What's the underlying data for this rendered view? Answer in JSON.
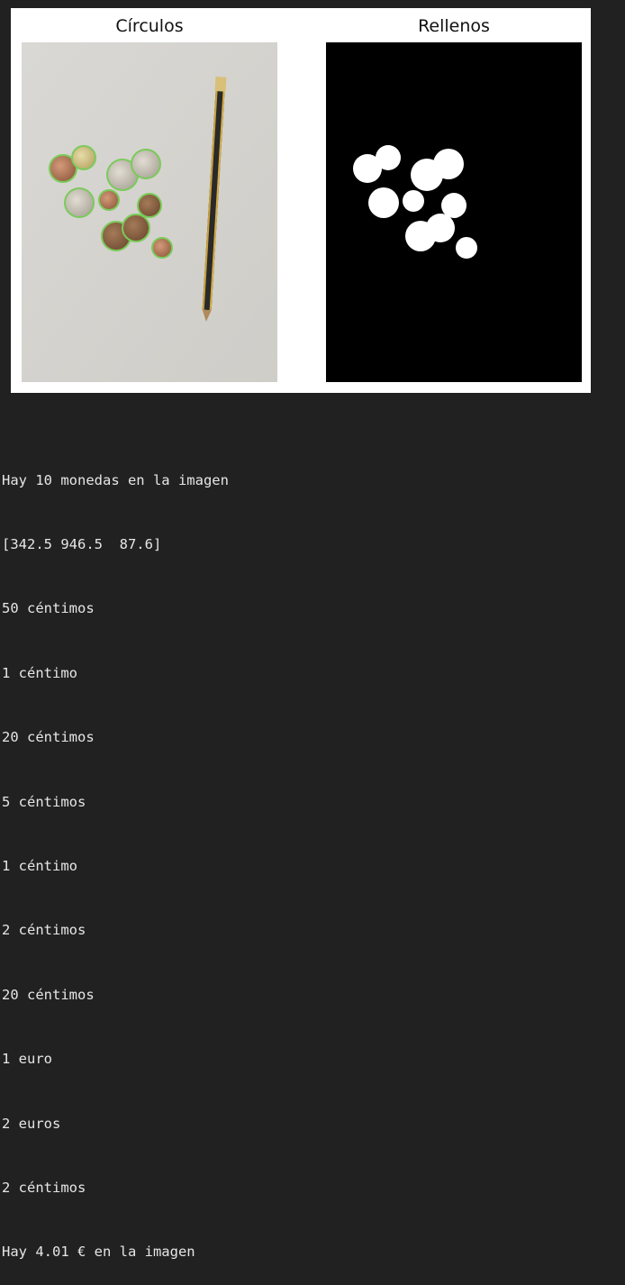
{
  "figure": {
    "panels": [
      {
        "title": "Círculos"
      },
      {
        "title": "Rellenos"
      }
    ]
  },
  "output": {
    "lines": [
      "Hay 10 monedas en la imagen",
      "[342.5 946.5  87.6]",
      "50 céntimos",
      "1 céntimo",
      "20 céntimos",
      "5 céntimos",
      "1 céntimo",
      "2 céntimos",
      "20 céntimos",
      "1 euro",
      "2 euros",
      "2 céntimos",
      "Hay 4.01 € en la imagen"
    ]
  }
}
